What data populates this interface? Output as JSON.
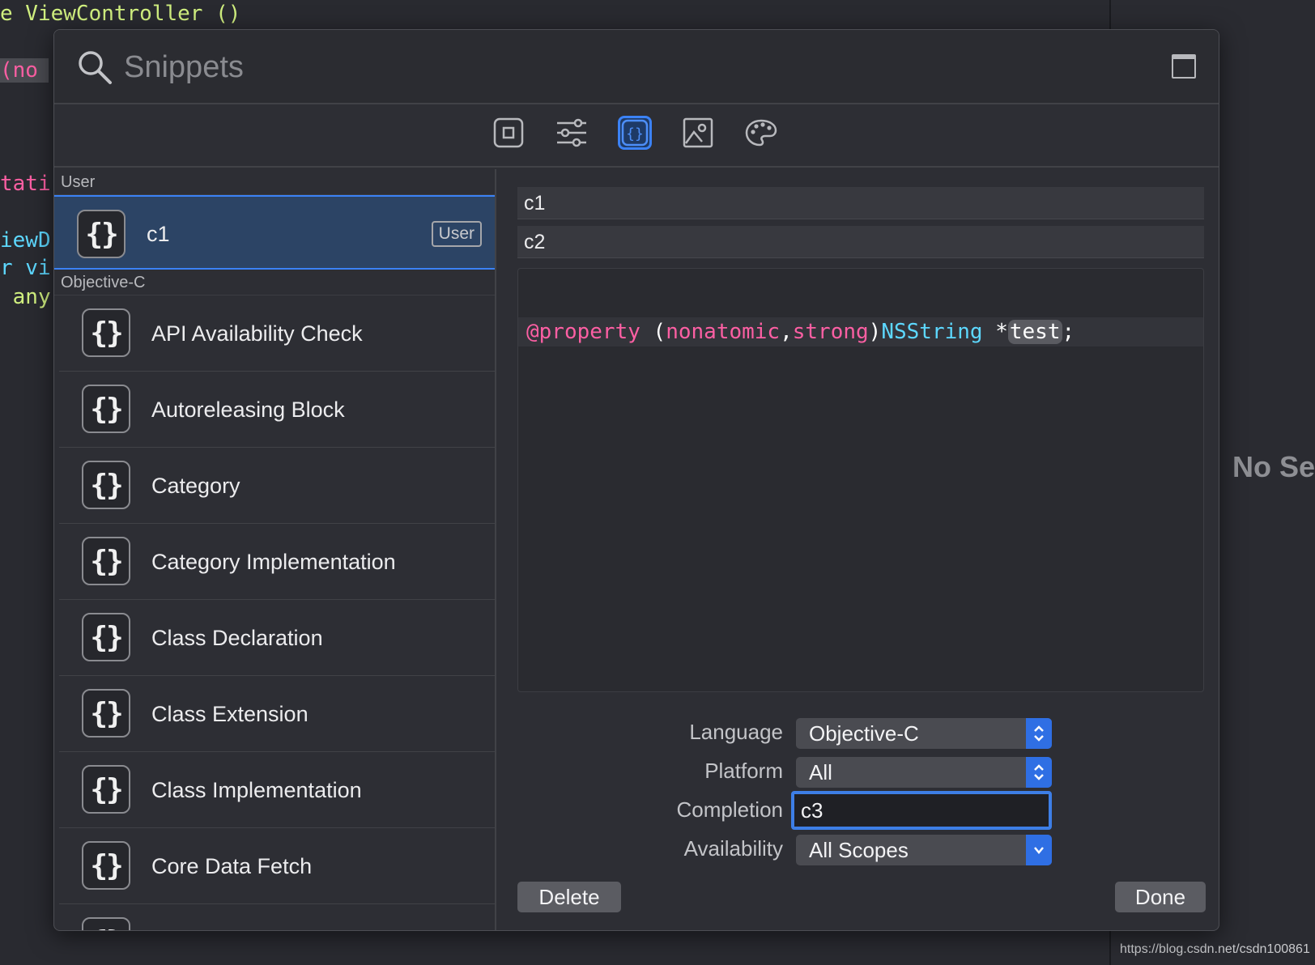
{
  "editor": {
    "lines": [
      {
        "text": "e ViewController ()",
        "color": "#d0ef7f"
      },
      {
        "text": "(no",
        "color": "#fc5fa3"
      },
      {
        "text": "tati",
        "color": "#fc5fa3"
      },
      {
        "text": "iewD",
        "color": "#5dd8ff"
      },
      {
        "text": "r vi",
        "color": "#5dd8ff"
      },
      {
        "text": " any",
        "color": "#d0ef7f"
      }
    ]
  },
  "right_pane": {
    "no_selection_text": "No Sel"
  },
  "watermark": {
    "url": "https://blog.csdn.net/csdn100861"
  },
  "search": {
    "placeholder": "Snippets",
    "value": ""
  },
  "toolbar": {
    "tabs": [
      {
        "icon": "views-icon",
        "active": false
      },
      {
        "icon": "modifiers-icon",
        "active": false
      },
      {
        "icon": "snippets-icon",
        "active": true
      },
      {
        "icon": "media-icon",
        "active": false
      },
      {
        "icon": "colors-icon",
        "active": false
      }
    ]
  },
  "sections": [
    {
      "title": "User",
      "items": [
        {
          "label": "c1",
          "badge": "User",
          "selected": true
        }
      ]
    },
    {
      "title": "Objective-C",
      "items": [
        {
          "label": "API Availability Check"
        },
        {
          "label": "Autoreleasing Block"
        },
        {
          "label": "Category"
        },
        {
          "label": "Category Implementation"
        },
        {
          "label": "Class Declaration"
        },
        {
          "label": "Class Extension"
        },
        {
          "label": "Class Implementation"
        },
        {
          "label": "Core Data Fetch"
        }
      ]
    }
  ],
  "icon_glyph": "{}",
  "detail": {
    "title": "c1",
    "summary": "c2",
    "code": {
      "keyword": "@property",
      "open_paren": " (",
      "attr1": "nonatomic",
      "comma": ",",
      "attr2": "strong",
      "close_paren": ")",
      "type": "NSString",
      "star": " *",
      "placeholder": "test",
      "semicolon": ";"
    },
    "language_label": "Language",
    "language_value": "Objective-C",
    "platform_label": "Platform",
    "platform_value": "All",
    "completion_label": "Completion",
    "completion_value": "c3",
    "availability_label": "Availability",
    "availability_value": "All Scopes",
    "delete_label": "Delete",
    "done_label": "Done"
  }
}
